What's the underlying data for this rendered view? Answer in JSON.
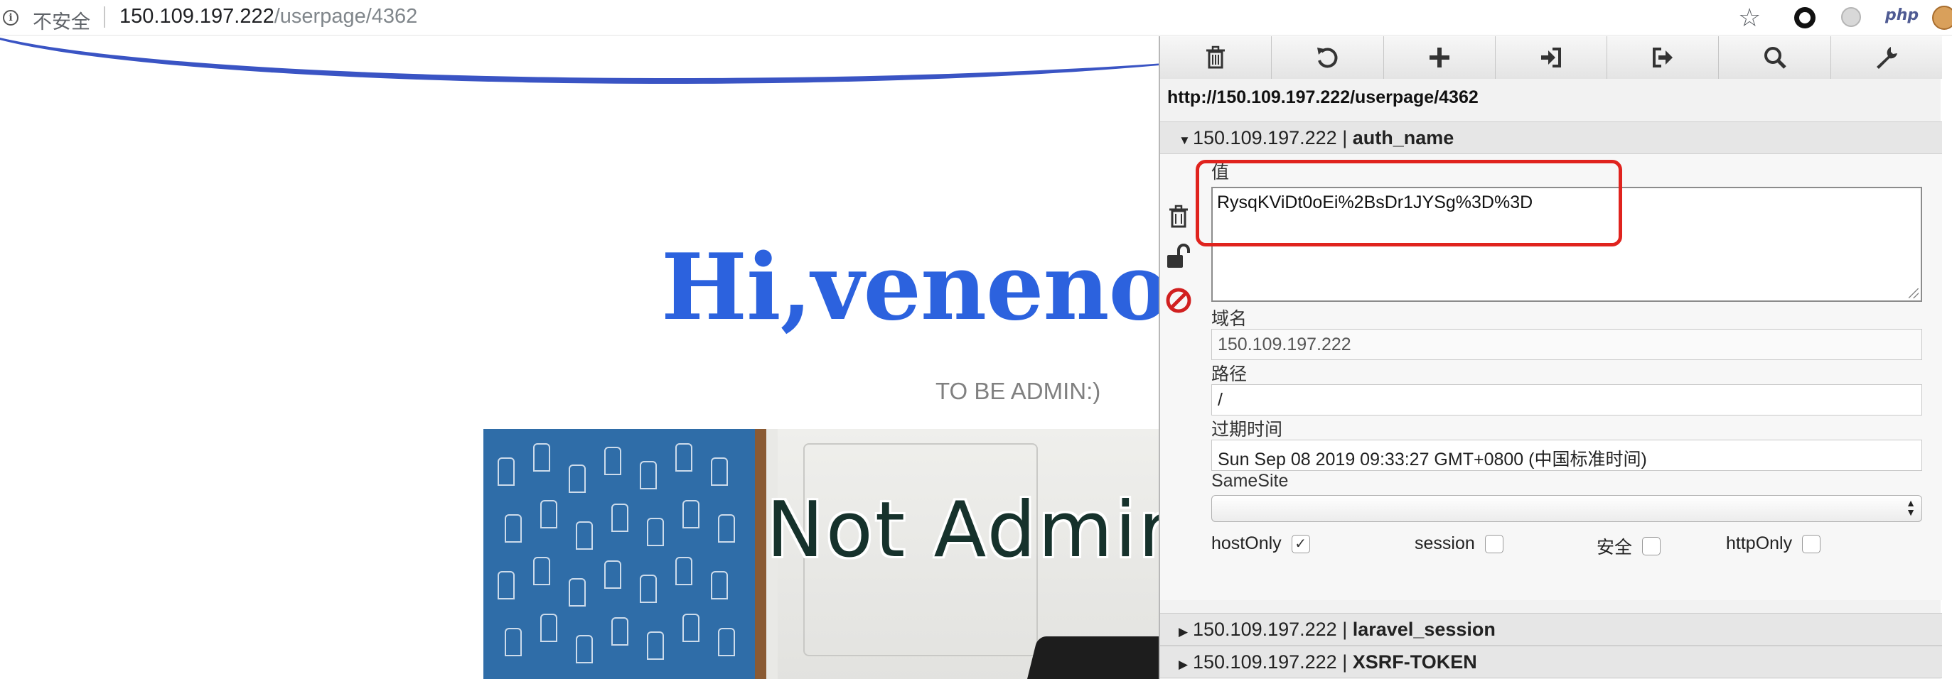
{
  "browser": {
    "security_label": "不安全",
    "url_host": "150.109.197.222",
    "url_path": "/userpage/4362",
    "php_extension_label": "php"
  },
  "page": {
    "title": "Hi,venenof",
    "subtitle": "TO BE ADMIN:)",
    "hero_text": "Not Admir",
    "colors": {
      "title": "#2c62de",
      "wave": "#3a54c4"
    }
  },
  "cookie_editor": {
    "toolbar": [
      {
        "name": "delete-all-button",
        "icon": "trash-icon"
      },
      {
        "name": "reload-button",
        "icon": "refresh-icon"
      },
      {
        "name": "add-cookie-button",
        "icon": "plus-icon"
      },
      {
        "name": "import-button",
        "icon": "import-icon"
      },
      {
        "name": "export-button",
        "icon": "export-icon"
      },
      {
        "name": "search-button",
        "icon": "search-icon"
      },
      {
        "name": "settings-button",
        "icon": "wrench-icon"
      }
    ],
    "url": "http://150.109.197.222/userpage/4362",
    "cookies": [
      {
        "host": "150.109.197.222",
        "separator": "|",
        "name": "auth_name",
        "expanded": true
      },
      {
        "host": "150.109.197.222",
        "separator": "|",
        "name": "laravel_session",
        "expanded": false
      },
      {
        "host": "150.109.197.222",
        "separator": "|",
        "name": "XSRF-TOKEN",
        "expanded": false
      }
    ],
    "form": {
      "value_label": "值",
      "value": "RysqKViDt0oEi%2BsDr1JYSg%3D%3D",
      "domain_label": "域名",
      "domain": "150.109.197.222",
      "path_label": "路径",
      "path": "/",
      "expires_label": "过期时间",
      "expires": "Sun Sep 08 2019 09:33:27 GMT+0800 (中国标准时间)",
      "samesite_label": "SameSite",
      "samesite": "",
      "flags": [
        {
          "label": "hostOnly",
          "checked": true
        },
        {
          "label": "session",
          "checked": false
        },
        {
          "label": "安全",
          "checked": false
        },
        {
          "label": "httpOnly",
          "checked": false
        }
      ]
    },
    "highlight_color": "#e0231e"
  }
}
